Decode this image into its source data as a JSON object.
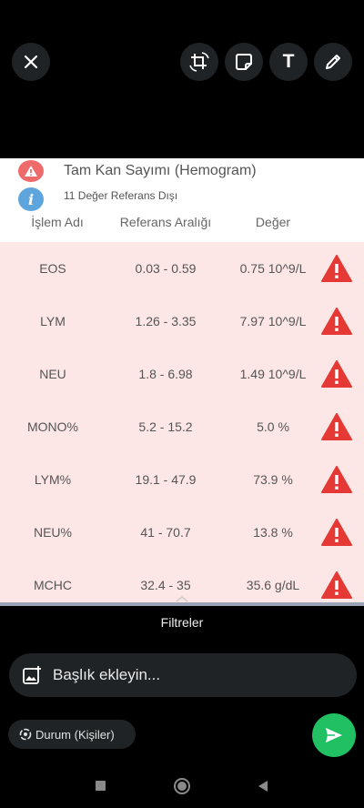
{
  "toolbar": {
    "close_icon": "close-icon",
    "crop_rotate_icon": "crop-rotate-icon",
    "sticker_icon": "sticker-icon",
    "text_tool_label": "T",
    "draw_icon": "pencil-icon"
  },
  "report": {
    "title": "Tam Kan Sayımı (Hemogram)",
    "subtitle": "11 Değer Referans Dışı",
    "columns": [
      "İşlem Adı",
      "Referans Aralığı",
      "Değer"
    ],
    "rows": [
      {
        "name": "EOS",
        "range": "0.03 - 0.59",
        "value": "0.75 10^9/L"
      },
      {
        "name": "LYM",
        "range": "1.26 - 3.35",
        "value": "7.97 10^9/L"
      },
      {
        "name": "NEU",
        "range": "1.8 - 6.98",
        "value": "1.49 10^9/L"
      },
      {
        "name": "MONO%",
        "range": "5.2 - 15.2",
        "value": "5.0 %"
      },
      {
        "name": "LYM%",
        "range": "19.1 - 47.9",
        "value": "73.9 %"
      },
      {
        "name": "NEU%",
        "range": "41 - 70.7",
        "value": "13.8 %"
      },
      {
        "name": "MCHC",
        "range": "32.4 - 35",
        "value": "35.6 g/dL"
      }
    ]
  },
  "filters_label": "Filtreler",
  "caption": {
    "placeholder": "Başlık ekleyin..."
  },
  "status_chip": {
    "label": "Durum (Kişiler)"
  },
  "colors": {
    "accent_green": "#21c063",
    "warning_red": "#e53935",
    "row_bg": "#fde6e6",
    "info_blue": "#5ea5dd"
  }
}
